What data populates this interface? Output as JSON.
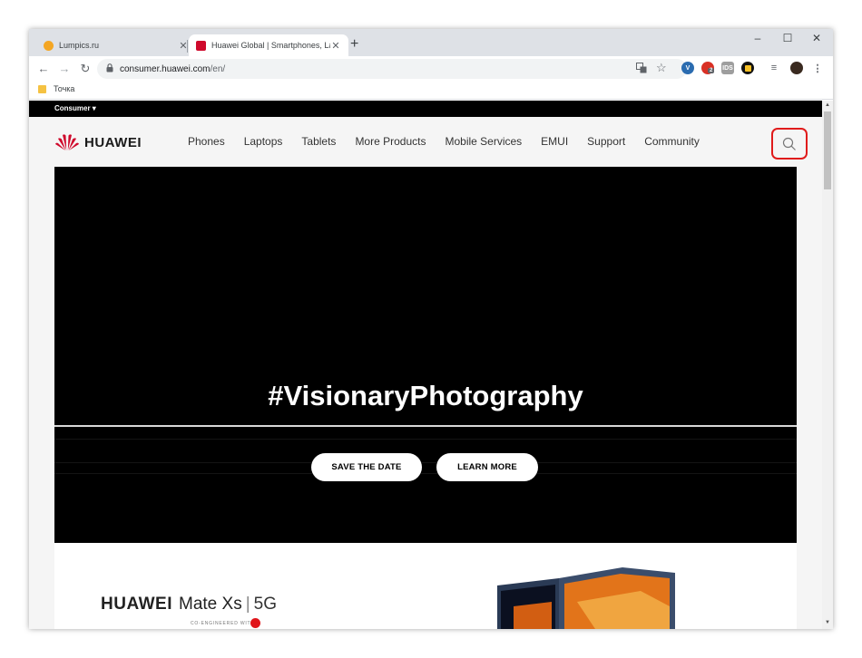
{
  "browser": {
    "tabs": [
      {
        "title": "Lumpics.ru",
        "favicon_color": "#f4a623",
        "active": false
      },
      {
        "title": "Huawei Global | Smartphones, La",
        "favicon_color": "#cf0a2c",
        "active": true
      }
    ],
    "new_tab_label": "+",
    "window_controls": {
      "minimize": "–",
      "maximize": "☐",
      "close": "✕"
    },
    "nav": {
      "back": "←",
      "forward": "→",
      "reload": "↻"
    },
    "address": {
      "host": "consumer.huawei.com",
      "path": "/en/"
    },
    "extensions": [
      {
        "name": "translate-icon"
      },
      {
        "name": "star-icon"
      },
      {
        "name": "vpn-extension-icon",
        "color": "#2b6cb0"
      },
      {
        "name": "adblock-extension-icon",
        "color": "#d93025",
        "badge": "2"
      },
      {
        "name": "ext-gray-icon",
        "color": "#9e9e9e",
        "label": "IDS"
      },
      {
        "name": "ext-yellow-icon",
        "color": "#111111"
      },
      {
        "name": "media-icon"
      },
      {
        "name": "profile-avatar-icon"
      },
      {
        "name": "menu-dots-icon"
      }
    ],
    "bookmarks": [
      {
        "label": "Точка"
      }
    ]
  },
  "page": {
    "topbar": {
      "consumer_label": "Consumer"
    },
    "header": {
      "logo_text": "HUAWEI",
      "nav_items": [
        "Phones",
        "Laptops",
        "Tablets",
        "More Products",
        "Mobile Services",
        "EMUI",
        "Support",
        "Community"
      ],
      "search_highlight_color": "#e01b1b"
    },
    "hero": {
      "title": "#VisionaryPhotography",
      "buttons": [
        {
          "label": "SAVE THE DATE"
        },
        {
          "label": "LEARN MORE"
        }
      ]
    },
    "product": {
      "brand": "HUAWEI",
      "model": "Mate Xs",
      "suffix": "5G",
      "tagline": "CO-ENGINEERED WITH"
    }
  }
}
